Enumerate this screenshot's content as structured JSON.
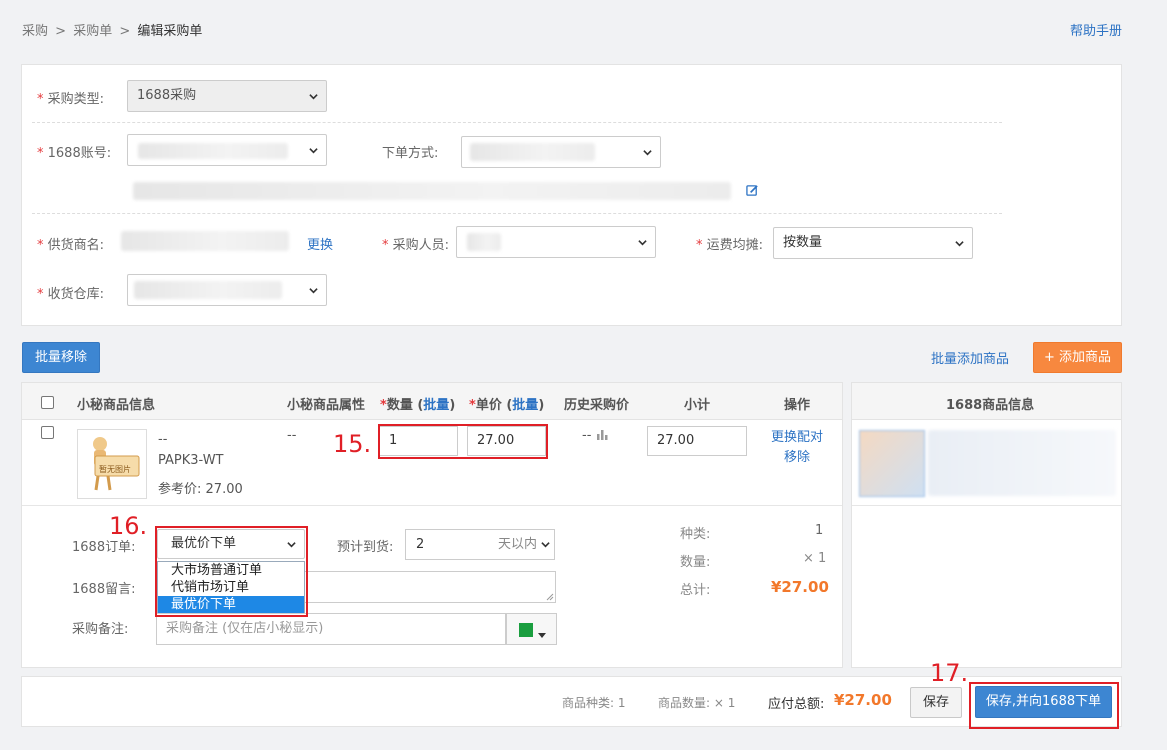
{
  "breadcrumb": {
    "items": [
      "采购",
      "采购单"
    ],
    "sep": ">",
    "current": "编辑采购单"
  },
  "help_link": "帮助手册",
  "form": {
    "purchase_type": {
      "label": "采购类型:",
      "value": "1688采购"
    },
    "account": {
      "label": "1688账号:"
    },
    "order_method": {
      "label": "下单方式:"
    },
    "supplier": {
      "label": "供货商名:",
      "change_link": "更换"
    },
    "buyer": {
      "label": "采购人员:"
    },
    "freight": {
      "label": "运费均摊:",
      "value": "按数量"
    },
    "warehouse": {
      "label": "收货仓库:"
    },
    "required_mark": "*",
    "edit_icon": "edit-icon"
  },
  "actions": {
    "batch_remove": "批量移除",
    "batch_add": "批量添加商品",
    "add_product": "+ 添加商品"
  },
  "table": {
    "headers": {
      "info": "小秘商品信息",
      "attr": "小秘商品属性",
      "qty": "数量",
      "qty_batch": "批量",
      "price": "单价",
      "price_batch": "批量",
      "history": "历史采购价",
      "subtotal": "小计",
      "ops": "操作",
      "right_panel": "1688商品信息"
    },
    "row": {
      "image_label": "暂无图片",
      "name": "--",
      "sku": "PAPK3-WT",
      "ref_price_label": "参考价:",
      "ref_price": "27.00",
      "attr": "--",
      "qty": "1",
      "price": "27.00",
      "history": "--",
      "history_icon": "bar-chart-icon",
      "subtotal": "27.00",
      "op_change": "更换配对",
      "op_remove": "移除"
    }
  },
  "order_detail": {
    "order_label": "1688订单:",
    "order_value": "最优价下单",
    "options": [
      "大市场普通订单",
      "代销市场订单",
      "最优价下单"
    ],
    "selected_index": 2,
    "arrival_label": "预计到货:",
    "arrival_value": "2",
    "arrival_unit": "天以内",
    "message_label": "1688留言:",
    "note_label": "采购备注:",
    "note_placeholder": "采购备注 (仅在店小秘显示)",
    "flag_color": "#1a9e3f"
  },
  "summary": {
    "kinds_label": "种类:",
    "kinds": "1",
    "count_label": "数量:",
    "count": "× 1",
    "total_label": "总计:",
    "total": "¥27.00"
  },
  "footer": {
    "kinds_label": "商品种类:",
    "kinds": "1",
    "count_label": "商品数量:",
    "count": "× 1",
    "pay_label": "应付总额:",
    "pay": "¥27.00",
    "save": "保存",
    "save_order": "保存,并向1688下单"
  },
  "annotations": [
    "15.",
    "16.",
    "17."
  ],
  "colors": {
    "accent": "#3d86d2",
    "orange": "#f7883f",
    "price": "#f2782b",
    "annotation": "#e01f26"
  }
}
